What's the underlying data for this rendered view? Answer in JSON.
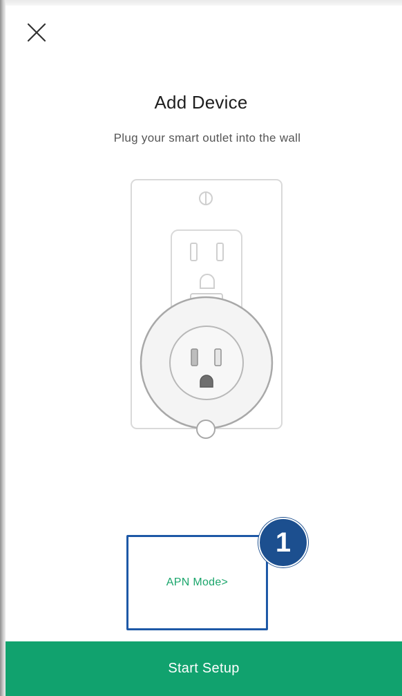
{
  "header": {
    "close_icon": "close-icon"
  },
  "main": {
    "title": "Add Device",
    "subtitle": "Plug your smart outlet into the wall",
    "illustration": "smart-outlet-plugged-into-wall-illustration"
  },
  "apn": {
    "label": "APN Mode>",
    "link_color": "#1aa56b",
    "highlight_color": "#1d58a6"
  },
  "annotation": {
    "step_number": "1",
    "badge_color": "#1c4f8f"
  },
  "footer": {
    "start_label": "Start Setup",
    "button_color": "#11a26e"
  }
}
